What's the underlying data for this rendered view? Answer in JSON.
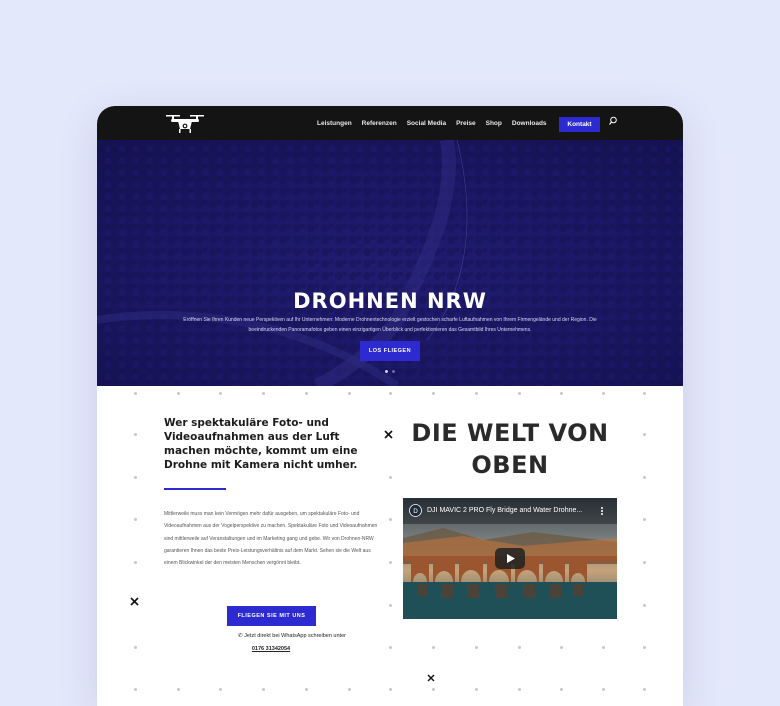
{
  "nav": {
    "items": [
      "Leistungen",
      "Referenzen",
      "Social Media",
      "Preise",
      "Shop",
      "Downloads"
    ],
    "kontakt": "Kontakt"
  },
  "hero": {
    "title": "DROHNEN NRW",
    "text": "Eröffnen Sie Ihren Kunden neue Perspektiven auf Ihr Unternehmen: Moderne Drohnentechnologie erzielt gestochen scharfe Luftaufnahmen von Ihrem Firmengelände und der Region. Die beeindruckenden Panoramafotos geben einen einzigartigen Überblick und perfektionieren das Gesamtbild Ihres Unternehmens.",
    "button": "LOS FLIEGEN"
  },
  "intro": {
    "headline": "Wer spektakuläre Foto- und Videoaufnahmen aus der Luft machen möchte, kommt um eine Drohne mit Kamera nicht umher.",
    "body": "Mittlerweile muss man kein Vermögen mehr dafür ausgeben, um spektakuläre Foto- und Videoaufnahmen aus der Vogelperspektive zu machen. Spektakuläre Foto und Videoaufnahmen sind mittlerweile auf Veranstaltungen und im Marketing gang und gebe. Wir von Drohnen-NRW garantieren Ihnen das beste Preis-Leistungsverhältnis auf dem Markt. Sehen sie die Welt aus einem Blickwinkel der den meisten Menschen vergönnt bleibt.",
    "button": "FLIEGEN SIE MIT UNS",
    "whatsapp": "Jetzt direkt bei WhatsApp schreiben unter",
    "phone": "0176 31342054"
  },
  "welt": {
    "line1": "DIE WELT VON",
    "line2": "OBEN"
  },
  "video": {
    "title": "DJI MAVIC 2 PRO Fly Bridge and Water Drohne..."
  },
  "colors": {
    "accent": "#2d2ad1",
    "hero_bg": "#1b1763",
    "topbar": "#141414"
  }
}
